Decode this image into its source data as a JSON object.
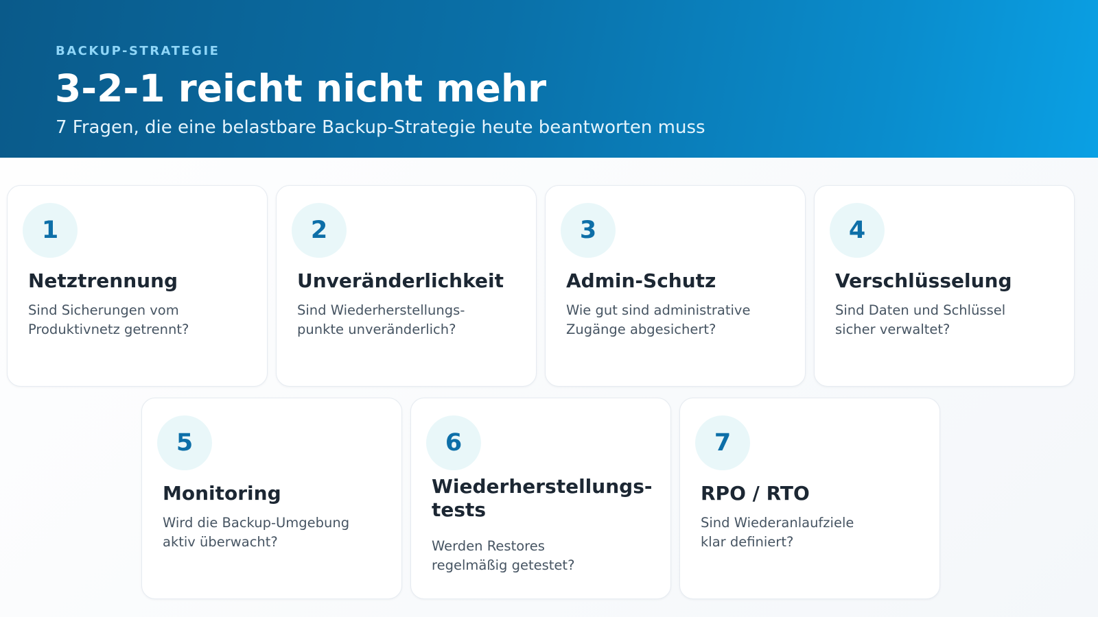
{
  "header": {
    "eyebrow": "BACKUP-STRATEGIE",
    "title": "3-2-1 reicht nicht mehr",
    "subtitle": "7 Fragen, die eine belastbare Backup-Strategie heute beantworten muss"
  },
  "cards": [
    {
      "number": "1",
      "title": "Netztrennung",
      "text_line1": "Sind Sicherungen vom",
      "text_line2": "Produktivnetz getrennt?"
    },
    {
      "number": "2",
      "title": "Unveränderlichkeit",
      "text_line1": "Sind Wiederherstellungs-",
      "text_line2": "punkte unveränderlich?"
    },
    {
      "number": "3",
      "title": "Admin-Schutz",
      "text_line1": "Wie gut sind administrative",
      "text_line2": "Zugänge abgesichert?"
    },
    {
      "number": "4",
      "title": "Verschlüsselung",
      "text_line1": "Sind Daten und Schlüssel",
      "text_line2": "sicher verwaltet?"
    },
    {
      "number": "5",
      "title": "Monitoring",
      "text_line1": "Wird die Backup-Umgebung",
      "text_line2": "aktiv überwacht?"
    },
    {
      "number": "6",
      "title_line1": "Wiederherstellungs-",
      "title_line2": "tests",
      "text_line1": "Werden Restores",
      "text_line2": "regelmäßig getestet?"
    },
    {
      "number": "7",
      "title": "RPO / RTO",
      "text_line1": "Sind Wiederanlaufziele",
      "text_line2": "klar definiert?"
    }
  ],
  "colors": {
    "hero_start": "#0a5a8a",
    "hero_end": "#0aa0e4",
    "accent": "#0d6fa8",
    "badge_bg": "#e9f7f9",
    "eyebrow": "#8fd6f8"
  }
}
